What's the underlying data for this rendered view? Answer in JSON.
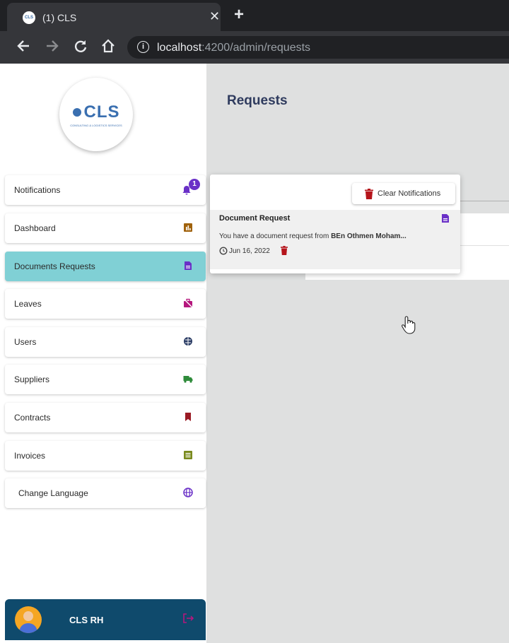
{
  "browser": {
    "tab_title": "(1) CLS",
    "favicon_text": "CLS",
    "close_glyph": "✕",
    "new_tab_glyph": "+",
    "url_host": "localhost",
    "url_rest": ":4200/admin/requests",
    "info_glyph": "i"
  },
  "sidebar": {
    "logo_text": "CLS",
    "logo_subtitle": "CONSULTING & LOGISTICS SERVICES",
    "items": [
      {
        "label": "Notifications",
        "icon": "bell-icon",
        "color": "#6a30c7"
      },
      {
        "label": "Dashboard",
        "icon": "chart-icon",
        "color": "#a0620c"
      },
      {
        "label": "Documents Requests",
        "icon": "document-icon",
        "color": "#6a30c7"
      },
      {
        "label": "Leaves",
        "icon": "suitcase-off-icon",
        "color": "#b5177d"
      },
      {
        "label": "Users",
        "icon": "globe-users-icon",
        "color": "#2c3e66"
      },
      {
        "label": "Suppliers",
        "icon": "truck-icon",
        "color": "#2e8b3a"
      },
      {
        "label": "Contracts",
        "icon": "bookmark-icon",
        "color": "#9a1a24"
      },
      {
        "label": "Invoices",
        "icon": "list-icon",
        "color": "#7a8a1e"
      },
      {
        "label": "Change Language",
        "icon": "globe-icon",
        "color": "#6a30c7"
      }
    ],
    "notification_badge": "1",
    "user_name": "CLS RH"
  },
  "main": {
    "page_title": "Requests",
    "clear_notifications_label": "Clear Notifications",
    "notification": {
      "title": "Document Request",
      "body_prefix": "You have a document request from ",
      "body_name": "BEn Othmen Moham...",
      "date": "Jun 16, 2022"
    }
  },
  "colors": {
    "accent_active": "#80d0d5",
    "userbar": "#0f4a6c",
    "delete_red": "#b5141b",
    "title": "#2f3b5e"
  }
}
